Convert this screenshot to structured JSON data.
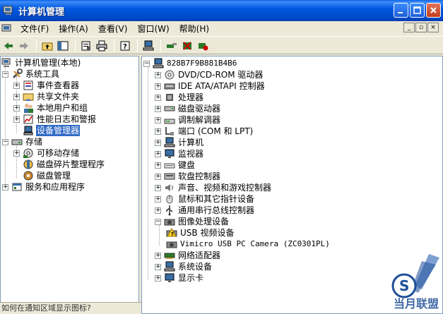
{
  "window": {
    "title": "计算机管理",
    "controls": {
      "minimize": "minimize",
      "maximize": "maximize",
      "close": "close"
    }
  },
  "menu": {
    "items": [
      "文件(F)",
      "操作(A)",
      "查看(V)",
      "窗口(W)",
      "帮助(H)"
    ]
  },
  "toolbar": {
    "buttons": [
      "back-icon",
      "forward-icon",
      "up-folder-icon",
      "show-hide-tree-icon",
      "properties-icon",
      "print-icon",
      "help-icon",
      "computer-icon",
      "scan-hardware-icon",
      "uninstall-icon",
      "disable-icon"
    ]
  },
  "left_tree": {
    "root": "计算机管理(本地)",
    "system_tools": "系统工具",
    "event_viewer": "事件查看器",
    "shared_folders": "共享文件夹",
    "local_users": "本地用户和组",
    "perf_logs": "性能日志和警报",
    "device_manager": "设备管理器",
    "storage": "存储",
    "removable_storage": "可移动存储",
    "defrag": "磁盘碎片整理程序",
    "disk_mgmt": "磁盘管理",
    "services_apps": "服务和应用程序"
  },
  "right_tree": {
    "computer_name": "828B7F9B881B4B6",
    "categories": {
      "dvd": "DVD/CD-ROM 驱动器",
      "ide": "IDE ATA/ATAPI 控制器",
      "cpu": "处理器",
      "disk": "磁盘驱动器",
      "modem": "调制解调器",
      "ports": "端口 (COM 和 LPT)",
      "computer": "计算机",
      "monitor": "监视器",
      "keyboard": "键盘",
      "floppy": "软盘控制器",
      "sound": "声音、视频和游戏控制器",
      "mouse": "鼠标和其它指针设备",
      "usb": "通用串行总线控制器",
      "imaging": "图像处理设备",
      "usb_video": "USB 视频设备",
      "vimicro": "Vimicro USB PC Camera (ZC0301PL)",
      "network": "网络适配器",
      "system": "系统设备",
      "display": "显示卡"
    }
  },
  "status": {
    "text": "如何在通知区域显示图标?"
  },
  "watermark": {
    "brand": "当月联盟"
  }
}
